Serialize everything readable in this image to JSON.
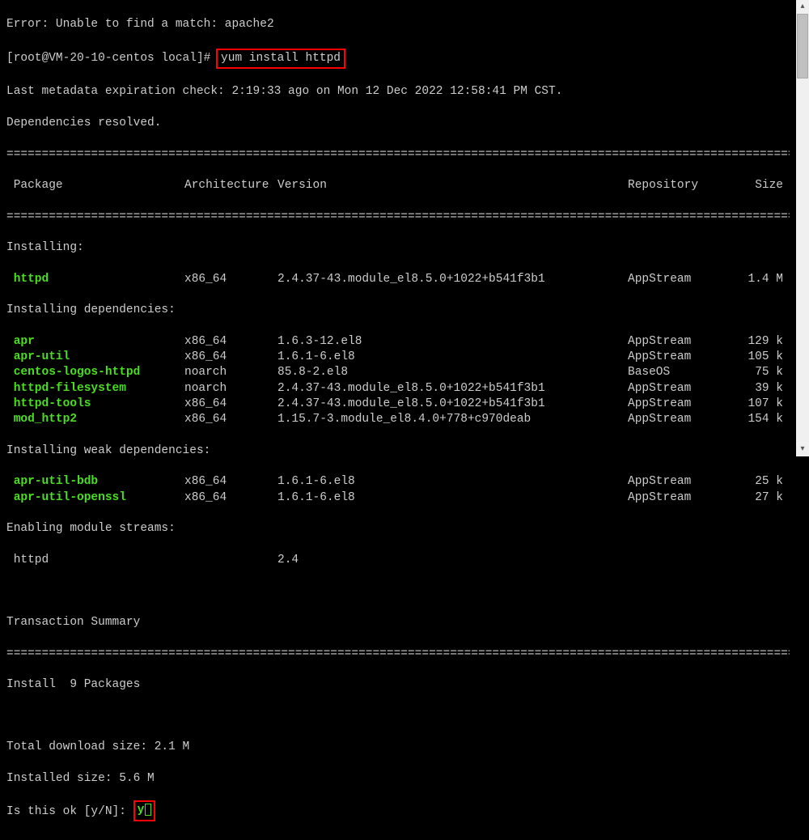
{
  "error_line": "Error: Unable to find a match: apache2",
  "prompt": "[root@VM-20-10-centos local]# ",
  "command": "yum install httpd",
  "meta_line": "Last metadata expiration check: 2:19:33 ago on Mon 12 Dec 2022 12:58:41 PM CST.",
  "deps_resolved": "Dependencies resolved.",
  "divider": "================================================================================================================",
  "headers": {
    "pkg": " Package",
    "arch": "Architecture",
    "ver": "Version",
    "repo": "Repository",
    "size": "Size"
  },
  "sections": {
    "installing": "Installing:",
    "installing_deps": "Installing dependencies:",
    "installing_weak": "Installing weak dependencies:",
    "enabling_streams": "Enabling module streams:"
  },
  "packages": {
    "main": [
      {
        "name": " httpd",
        "arch": "x86_64",
        "ver": "2.4.37-43.module_el8.5.0+1022+b541f3b1",
        "repo": "AppStream",
        "size": "1.4 M"
      }
    ],
    "deps": [
      {
        "name": " apr",
        "arch": "x86_64",
        "ver": "1.6.3-12.el8",
        "repo": "AppStream",
        "size": "129 k"
      },
      {
        "name": " apr-util",
        "arch": "x86_64",
        "ver": "1.6.1-6.el8",
        "repo": "AppStream",
        "size": "105 k"
      },
      {
        "name": " centos-logos-httpd",
        "arch": "noarch",
        "ver": "85.8-2.el8",
        "repo": "BaseOS",
        "size": "75 k"
      },
      {
        "name": " httpd-filesystem",
        "arch": "noarch",
        "ver": "2.4.37-43.module_el8.5.0+1022+b541f3b1",
        "repo": "AppStream",
        "size": "39 k"
      },
      {
        "name": " httpd-tools",
        "arch": "x86_64",
        "ver": "2.4.37-43.module_el8.5.0+1022+b541f3b1",
        "repo": "AppStream",
        "size": "107 k"
      },
      {
        "name": " mod_http2",
        "arch": "x86_64",
        "ver": "1.15.7-3.module_el8.4.0+778+c970deab",
        "repo": "AppStream",
        "size": "154 k"
      }
    ],
    "weak": [
      {
        "name": " apr-util-bdb",
        "arch": "x86_64",
        "ver": "1.6.1-6.el8",
        "repo": "AppStream",
        "size": "25 k"
      },
      {
        "name": " apr-util-openssl",
        "arch": "x86_64",
        "ver": "1.6.1-6.el8",
        "repo": "AppStream",
        "size": "27 k"
      }
    ],
    "streams": [
      {
        "name": " httpd",
        "arch": "",
        "ver": "2.4",
        "repo": "",
        "size": ""
      }
    ]
  },
  "txn_summary": "Transaction Summary",
  "install_count": "Install  9 Packages",
  "dl_size": "Total download size: 2.1 M",
  "inst_size": "Installed size: 5.6 M",
  "confirm_prompt": "Is this ok [y/N]: ",
  "confirm_answer": "y"
}
